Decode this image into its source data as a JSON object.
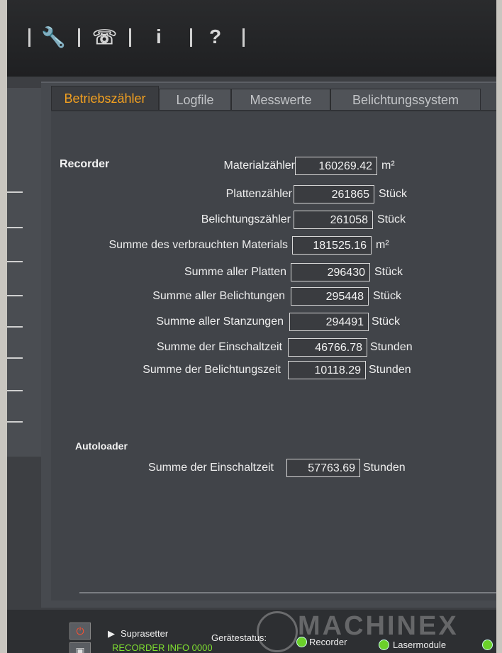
{
  "toolbar": {
    "wrench_icon": "wrench-icon",
    "satellite_icon": "satellite-icon",
    "info_label": "i",
    "help_label": "?"
  },
  "tabs": [
    {
      "label": "Betriebszähler",
      "active": true
    },
    {
      "label": "Logfile",
      "active": false
    },
    {
      "label": "Messwerte",
      "active": false
    },
    {
      "label": "Belichtungssystem",
      "active": false
    }
  ],
  "recorder": {
    "title": "Recorder",
    "rows": [
      {
        "label": "Materialzähler",
        "value": "160269.42",
        "unit": "m²"
      },
      {
        "label": "Plattenzähler",
        "value": "261865",
        "unit": "Stück"
      },
      {
        "label": "Belichtungszähler",
        "value": "261058",
        "unit": "Stück"
      },
      {
        "label": "Summe des verbrauchten Materials",
        "value": "181525.16",
        "unit": "m²"
      },
      {
        "label": "Summe aller Platten",
        "value": "296430",
        "unit": "Stück"
      },
      {
        "label": "Summe aller Belichtungen",
        "value": "295448",
        "unit": "Stück"
      },
      {
        "label": "Summe aller Stanzungen",
        "value": "294491",
        "unit": "Stück"
      },
      {
        "label": "Summe der Einschaltzeit",
        "value": "46766.78",
        "unit": "Stunden"
      },
      {
        "label": "Summe der Belichtungszeit",
        "value": "10118.29",
        "unit": "Stunden"
      }
    ]
  },
  "autoloader": {
    "title": "Autoloader",
    "rows": [
      {
        "label": "Summe der Einschaltzeit",
        "value": "57763.69",
        "unit": "Stunden"
      }
    ]
  },
  "statusbar": {
    "suprasetter": "Suprasetter",
    "geraetestatus": "Gerätestatus:",
    "recorder": "Recorder",
    "lasermodule": "Lasermodule",
    "info_line": "RECORDER INFO 0000"
  },
  "watermark": "MACHINEX",
  "colors": {
    "accent": "#f2a020",
    "led_green": "#6bd02a"
  }
}
